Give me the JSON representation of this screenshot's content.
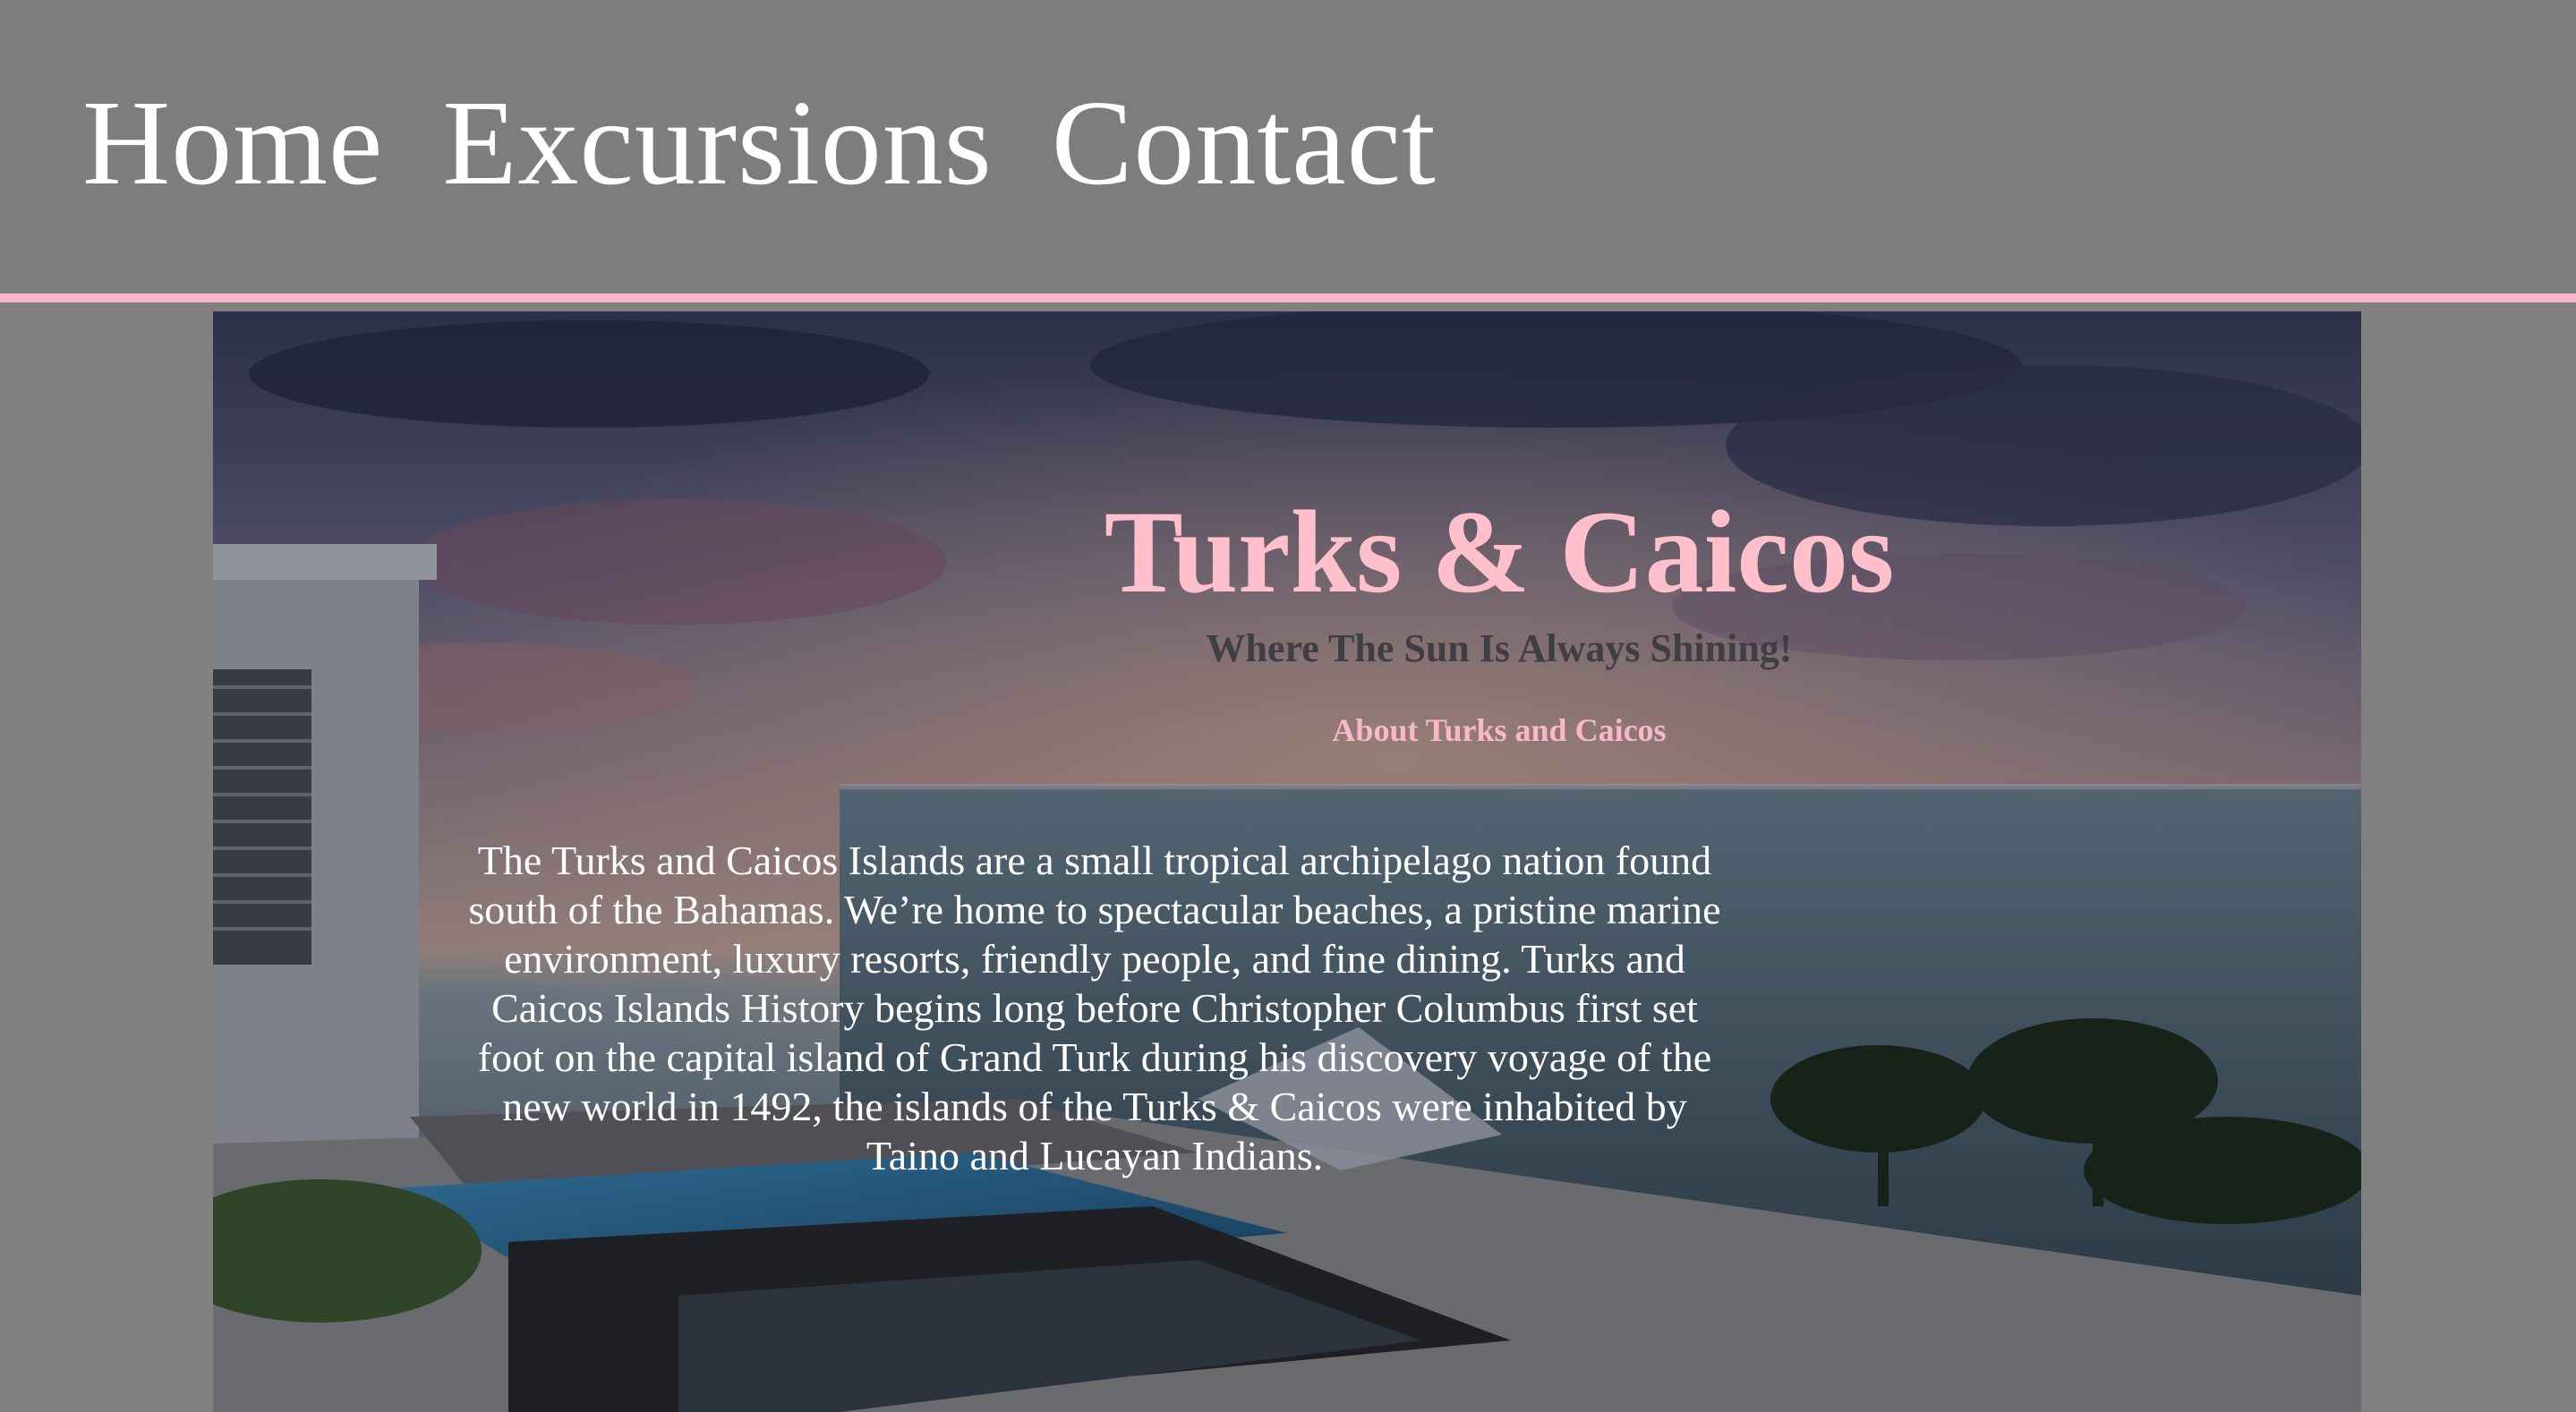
{
  "nav": {
    "items": [
      {
        "label": "Home"
      },
      {
        "label": "Excursions"
      },
      {
        "label": "Contact"
      }
    ]
  },
  "hero": {
    "title": "Turks & Caicos",
    "subtitle": "Where The Sun Is Always Shining!",
    "section_heading": "About Turks and Caicos",
    "paragraph": "The Turks and Caicos Islands are a small tropical archipelago nation found south of the Bahamas. We’re home to spectacular beaches, a pristine marine environment, luxury resorts, friendly people, and fine dining. Turks and Caicos Islands History begins long before Christopher Columbus first set foot on the capital island of Grand Turk during his discovery voyage of the new world in 1492, the islands of the Turks & Caicos were inhabited by Taino and Lucayan Indians."
  },
  "colors": {
    "accent_pink": "#ffc0cb",
    "header_bg": "#7d7d7d",
    "border_pink": "#f6b6c8"
  }
}
